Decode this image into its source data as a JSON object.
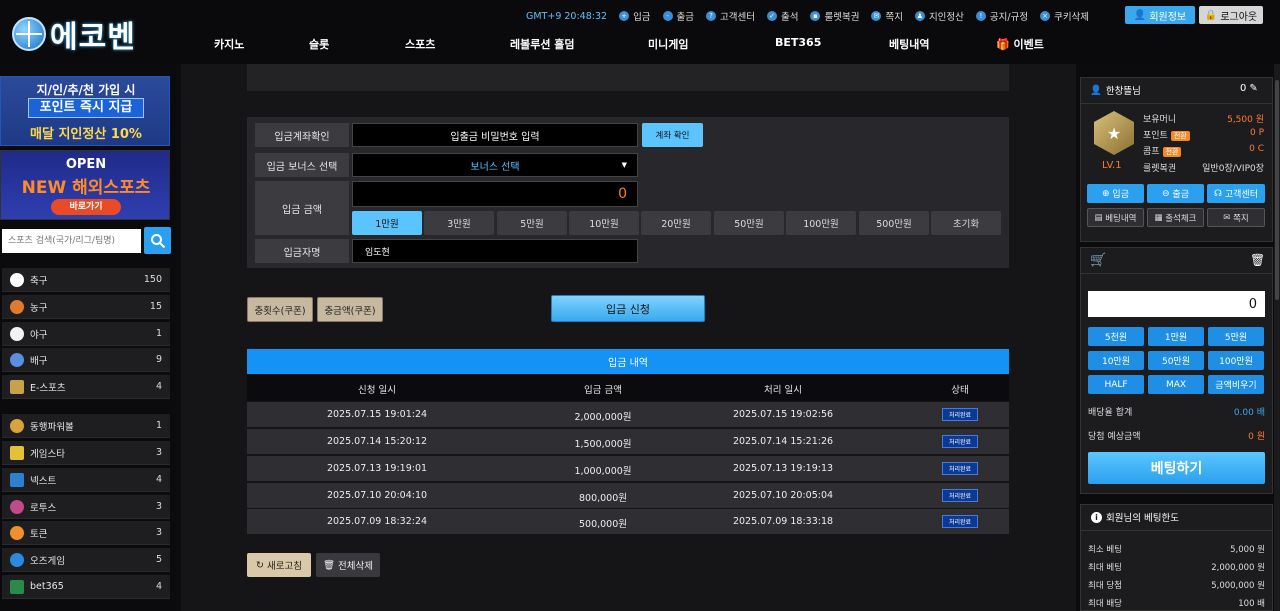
{
  "header": {
    "logo_text": "에코벤",
    "clock": "GMT+9 20:48:32",
    "top_links": [
      "입금",
      "출금",
      "고객센터",
      "출석",
      "룰렛복권",
      "쪽지",
      "지인정산",
      "공지/규정",
      "쿠키삭제"
    ],
    "member_info": "회원정보",
    "logout": "로그아웃"
  },
  "nav": [
    "카지노",
    "슬롯",
    "스포츠",
    "레볼루션 홀덤",
    "미니게임",
    "BET365",
    "베팅내역",
    "이벤트"
  ],
  "banners": {
    "b1_line1": "지/인/추/천 가입 시",
    "b1_line2": "포인트 즉시 지급",
    "b1_line3": "매달 지인정산 10%",
    "b2_line1": "OPEN",
    "b2_line2": "NEW 해외스포츠",
    "b2_line3": "바로가기"
  },
  "sport_search": {
    "placeholder": "스포츠 검색(국가/리그/팀명)"
  },
  "sports": [
    {
      "name": "축구",
      "count": "150"
    },
    {
      "name": "농구",
      "count": "15"
    },
    {
      "name": "야구",
      "count": "1"
    },
    {
      "name": "배구",
      "count": "9"
    },
    {
      "name": "E-스포츠",
      "count": "4"
    }
  ],
  "minigames": [
    {
      "name": "동행파워볼",
      "count": "1"
    },
    {
      "name": "게임스타",
      "count": "3"
    },
    {
      "name": "넥스트",
      "count": "4"
    },
    {
      "name": "로투스",
      "count": "3"
    },
    {
      "name": "토큰",
      "count": "3"
    },
    {
      "name": "오즈게임",
      "count": "5"
    },
    {
      "name": "bet365",
      "count": "4"
    }
  ],
  "deposit_form": {
    "account_check_label": "입금계좌확인",
    "password_placeholder": "입출금 비밀번호 입력",
    "account_check_btn": "계좌 확인",
    "bonus_label": "입금 보너스 선택",
    "bonus_value": "보너스 선택",
    "amount_label": "입금 금액",
    "amount_value": "0",
    "amount_buttons": [
      "1만원",
      "3만원",
      "5만원",
      "10만원",
      "20만원",
      "50만원",
      "100만원",
      "500만원",
      "초기화"
    ],
    "depositor_label": "입금자명",
    "depositor_value": "임도현",
    "coupon_count": "충횟수(쿠폰)",
    "coupon_amount": "충금액(쿠폰)",
    "apply_btn": "입금 신청"
  },
  "history": {
    "title": "입금 내역",
    "columns": [
      "신청 일시",
      "입금 금액",
      "처리 일시",
      "상태"
    ],
    "rows": [
      {
        "requested": "2025.07.15 19:01:24",
        "amount": "2,000,000원",
        "processed": "2025.07.15 19:02:56",
        "status": "처리완료"
      },
      {
        "requested": "2025.07.14 15:20:12",
        "amount": "1,500,000원",
        "processed": "2025.07.14 15:21:26",
        "status": "처리완료"
      },
      {
        "requested": "2025.07.13 19:19:01",
        "amount": "1,000,000원",
        "processed": "2025.07.13 19:19:13",
        "status": "처리완료"
      },
      {
        "requested": "2025.07.10 20:04:10",
        "amount": "800,000원",
        "processed": "2025.07.10 20:05:04",
        "status": "처리완료"
      },
      {
        "requested": "2025.07.09 18:32:24",
        "amount": "500,000원",
        "processed": "2025.07.09 18:33:18",
        "status": "처리완료"
      }
    ],
    "refresh": "새로고침",
    "delete_all": "전체삭제"
  },
  "user_panel": {
    "username": "한창뜰님",
    "message_count": "0",
    "level": "LV.1",
    "money_label": "보유머니",
    "money_value": "5,500 원",
    "point_label": "포인트",
    "point_value": "0 P",
    "comp_label": "콤프",
    "comp_value": "0 C",
    "convert": "전환",
    "roulette_label": "룰렛복권",
    "roulette_value": "일반0장/VIP0장",
    "btn_deposit": "입금",
    "btn_withdraw": "출금",
    "btn_support": "고객센터",
    "btn_bethistory": "베팅내역",
    "btn_attendance": "출석체크",
    "btn_message": "쪽지"
  },
  "betslip": {
    "amount_value": "0",
    "chips": [
      "5천원",
      "1만원",
      "5만원",
      "10만원",
      "50만원",
      "100만원",
      "HALF",
      "MAX",
      "금액비우기"
    ],
    "odds_label": "배당율 합계",
    "odds_value": "0.00 배",
    "win_label": "당첨 예상금액",
    "win_value": "0 원",
    "bet_btn": "베팅하기"
  },
  "limits": {
    "title": "회원님의 베팅한도",
    "rows": [
      {
        "k": "최소 베팅",
        "v": "5,000 원"
      },
      {
        "k": "최대 베팅",
        "v": "2,000,000 원"
      },
      {
        "k": "최대 당첨",
        "v": "5,000,000 원"
      },
      {
        "k": "최대 배당",
        "v": "100 배"
      }
    ]
  },
  "colors": {
    "accent": "#2aa0ee",
    "orange": "#ff7b2e",
    "hist_title": "#1592f5"
  }
}
